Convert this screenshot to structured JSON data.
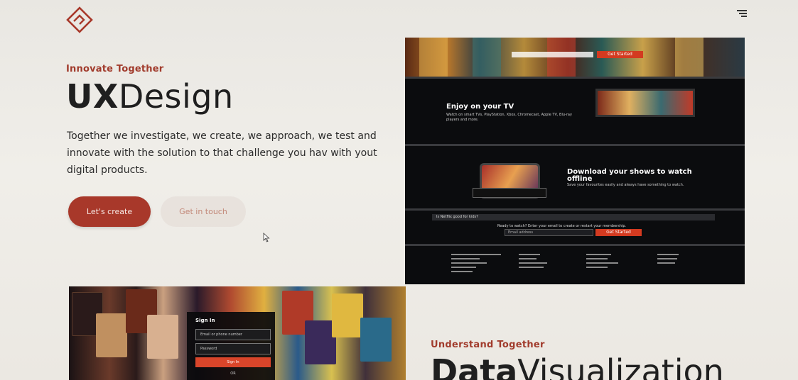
{
  "header": {
    "logo_icon": "diamond-logo-icon",
    "menu_icon": "hamburger-menu-icon"
  },
  "hero": {
    "eyebrow": "Innovate Together",
    "title_bold": "UX",
    "title_light": "Design",
    "description": "Together we investigate, we create, we approach, we test and innovate with the solution to that challenge you hav with yout digital products.",
    "primary_button": "Let's create",
    "secondary_button": "Get in touch"
  },
  "showcase_screen": {
    "hero_button": "Get Started",
    "tv_heading": "Enjoy on your TV",
    "tv_text": "Watch on smart TVs, PlayStation, Xbox, Chromecast, Apple TV, Blu-ray players and more.",
    "download_heading": "Download your shows to watch offline",
    "download_text": "Save your favourites easily and always have something to watch.",
    "faq_item": "Is Netflix good for kids?",
    "cta_text": "Ready to watch? Enter your email to create or restart your membership.",
    "cta_input_placeholder": "Email address",
    "cta_button": "Get Started"
  },
  "signin_screen": {
    "title": "Sign In",
    "email_placeholder": "Email or phone number",
    "password_placeholder": "Password",
    "button": "Sign In",
    "or": "OR"
  },
  "section2": {
    "eyebrow": "Understand Together",
    "title_bold": "Data",
    "title_light": "Visualization"
  },
  "colors": {
    "accent": "#a8382a",
    "background": "#ebe9e4",
    "text": "#1f1f1f"
  }
}
